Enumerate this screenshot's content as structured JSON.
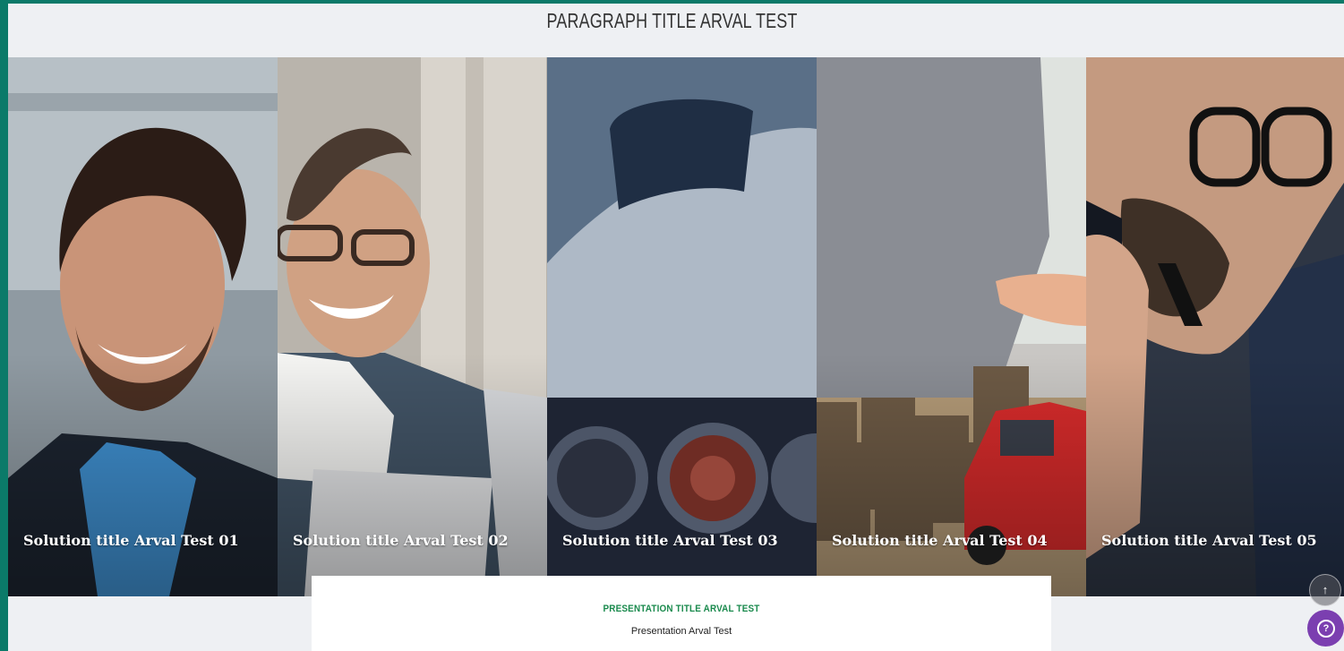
{
  "page": {
    "paragraph_title": "PARAGRAPH TITLE ARVAL TEST",
    "accent_color": "#0b7a69"
  },
  "solutions": [
    {
      "title": "Solution title Arval Test 01",
      "image": "smiling-man-looking-up"
    },
    {
      "title": "Solution title Arval Test 02",
      "image": "smiling-man-with-glasses-and-laptop"
    },
    {
      "title": "Solution title Arval Test 03",
      "image": "car-rear-lights-closeup"
    },
    {
      "title": "Solution title Arval Test 04",
      "image": "coin-stacks-and-red-toy-car"
    },
    {
      "title": "Solution title Arval Test 05",
      "image": "man-with-glasses-on-phone"
    }
  ],
  "presentation": {
    "title": "PRESENTATION TITLE ARVAL TEST",
    "text": "Presentation Arval Test",
    "title_color": "#1a8a4d"
  },
  "controls": {
    "scroll_top_icon": "arrow-up-icon",
    "help_icon": "question-chat-icon",
    "help_color": "#7b3fb0"
  }
}
